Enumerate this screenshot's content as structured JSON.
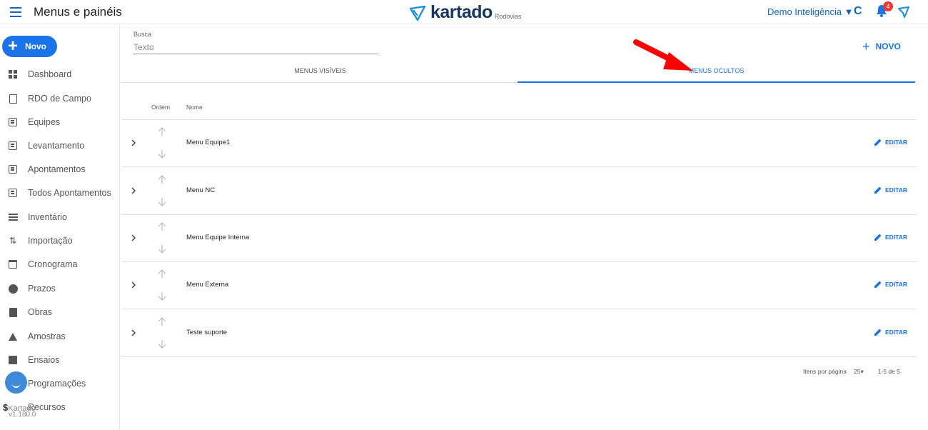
{
  "header": {
    "title": "Menus e painéis",
    "logo_text": "kartado",
    "logo_sub": "Rodovias",
    "workspace": "Demo Inteligência ▼",
    "refresh_glyph": "C",
    "notification_count": "4",
    "accent": "#1a73e8"
  },
  "sidebar": {
    "new_button": "Novo",
    "items": [
      {
        "label": "Dashboard",
        "icon": "dashboard-icon"
      },
      {
        "label": "RDO de Campo",
        "icon": "clipboard-icon"
      },
      {
        "label": "Equipes",
        "icon": "list-box-icon"
      },
      {
        "label": "Levantamento",
        "icon": "list-box-icon"
      },
      {
        "label": "Apontamentos",
        "icon": "list-box-icon"
      },
      {
        "label": "Todos Apontamentos",
        "icon": "list-box-icon"
      },
      {
        "label": "Inventário",
        "icon": "lines-icon"
      },
      {
        "label": "Importação",
        "icon": "import-arrows-icon"
      },
      {
        "label": "Cronograma",
        "icon": "calendar-icon"
      },
      {
        "label": "Prazos",
        "icon": "clock-icon"
      },
      {
        "label": "Obras",
        "icon": "clipboard-filled-icon"
      },
      {
        "label": "Amostras",
        "icon": "flask-icon"
      },
      {
        "label": "Ensaios",
        "icon": "test-icon"
      },
      {
        "label": "Programações",
        "icon": "schedule-icon"
      },
      {
        "label": "Recursos",
        "icon": "dollar-icon"
      }
    ],
    "brand_small": "Kartado",
    "version": "v1.180.0"
  },
  "search": {
    "label": "Busca",
    "placeholder": "Texto"
  },
  "toolbar": {
    "new_label": "NOVO"
  },
  "tabs": [
    {
      "label": "MENUS VISÍVEIS",
      "active": false
    },
    {
      "label": "MENUS OCULTOS",
      "active": true
    }
  ],
  "table": {
    "columns": [
      "Ordem",
      "Nome"
    ],
    "rows": [
      {
        "name": "Menu Equipe1"
      },
      {
        "name": "Menu NC"
      },
      {
        "name": "Menu Equipe Interna"
      },
      {
        "name": "Menu Externa"
      },
      {
        "name": "Teste suporte"
      }
    ],
    "edit_label": "EDITAR"
  },
  "pagination": {
    "items_per_page_label": "Itens por página",
    "per_page": "25",
    "range": "1-5 de 5"
  }
}
